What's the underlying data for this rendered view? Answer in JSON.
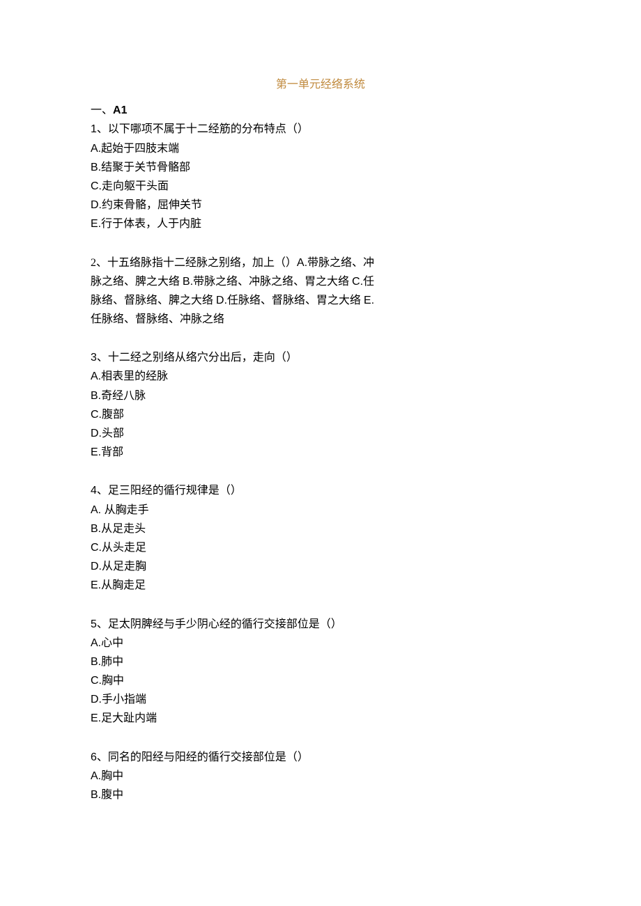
{
  "title": "第一单元经络系统",
  "section_prefix": "一、",
  "section_code": "A1",
  "questions": [
    {
      "num": "1、",
      "stem": "以下哪项不属于十二经筋的分布特点（）",
      "options": [
        {
          "letter": "A.",
          "text": "起始于四肢末端"
        },
        {
          "letter": "B.",
          "text": "结聚于关节骨骼部"
        },
        {
          "letter": "C.",
          "text": "走向躯干头面"
        },
        {
          "letter": "D.",
          "text": "约束骨骼，屈伸关节"
        },
        {
          "letter": "E.",
          "text": "行于体表，人于内脏"
        }
      ],
      "inline": false
    },
    {
      "num": "2、",
      "stem": "十五络脉指十二经脉之别络，加上（）",
      "options": [
        {
          "letter": "A.",
          "text": "带脉之络、冲脉之络、脾之大络 "
        },
        {
          "letter": "B.",
          "text": "带脉之络、冲脉之络、胃之大络 "
        },
        {
          "letter": "C.",
          "text": "任脉络、督脉络、脾之大络 "
        },
        {
          "letter": "D.",
          "text": "任脉络、督脉络、胃之大络 "
        },
        {
          "letter": "E.",
          "text": "任脉络、督脉络、冲脉之络"
        }
      ],
      "inline": true
    },
    {
      "num": "3、",
      "stem": "十二经之别络从络穴分出后，走向（）",
      "options": [
        {
          "letter": "A.",
          "text": "相表里的经脉"
        },
        {
          "letter": "B.",
          "text": "奇经八脉"
        },
        {
          "letter": "C.",
          "text": "腹部"
        },
        {
          "letter": "D.",
          "text": "头部"
        },
        {
          "letter": "E.",
          "text": "背部"
        }
      ],
      "inline": false
    },
    {
      "num": "4、",
      "stem": "足三阳经的循行规律是（）",
      "options": [
        {
          "letter": "A. ",
          "text": "从胸走手"
        },
        {
          "letter": "B.",
          "text": "从足走头"
        },
        {
          "letter": "C.",
          "text": "从头走足"
        },
        {
          "letter": "D.",
          "text": "从足走胸"
        },
        {
          "letter": "E.",
          "text": "从胸走足"
        }
      ],
      "inline": false
    },
    {
      "num": "5、",
      "stem": "足太阴脾经与手少阴心经的循行交接部位是（）",
      "options": [
        {
          "letter": "A.",
          "text": "心中"
        },
        {
          "letter": "B.",
          "text": "肺中"
        },
        {
          "letter": "C.",
          "text": "胸中"
        },
        {
          "letter": "D.",
          "text": "手小指端"
        },
        {
          "letter": "E.",
          "text": "足大趾内端"
        }
      ],
      "inline": false
    },
    {
      "num": "6、",
      "stem": "同名的阳经与阳经的循行交接部位是（）",
      "options": [
        {
          "letter": "A.",
          "text": "胸中"
        },
        {
          "letter": "B.",
          "text": "腹中"
        }
      ],
      "inline": false
    }
  ]
}
